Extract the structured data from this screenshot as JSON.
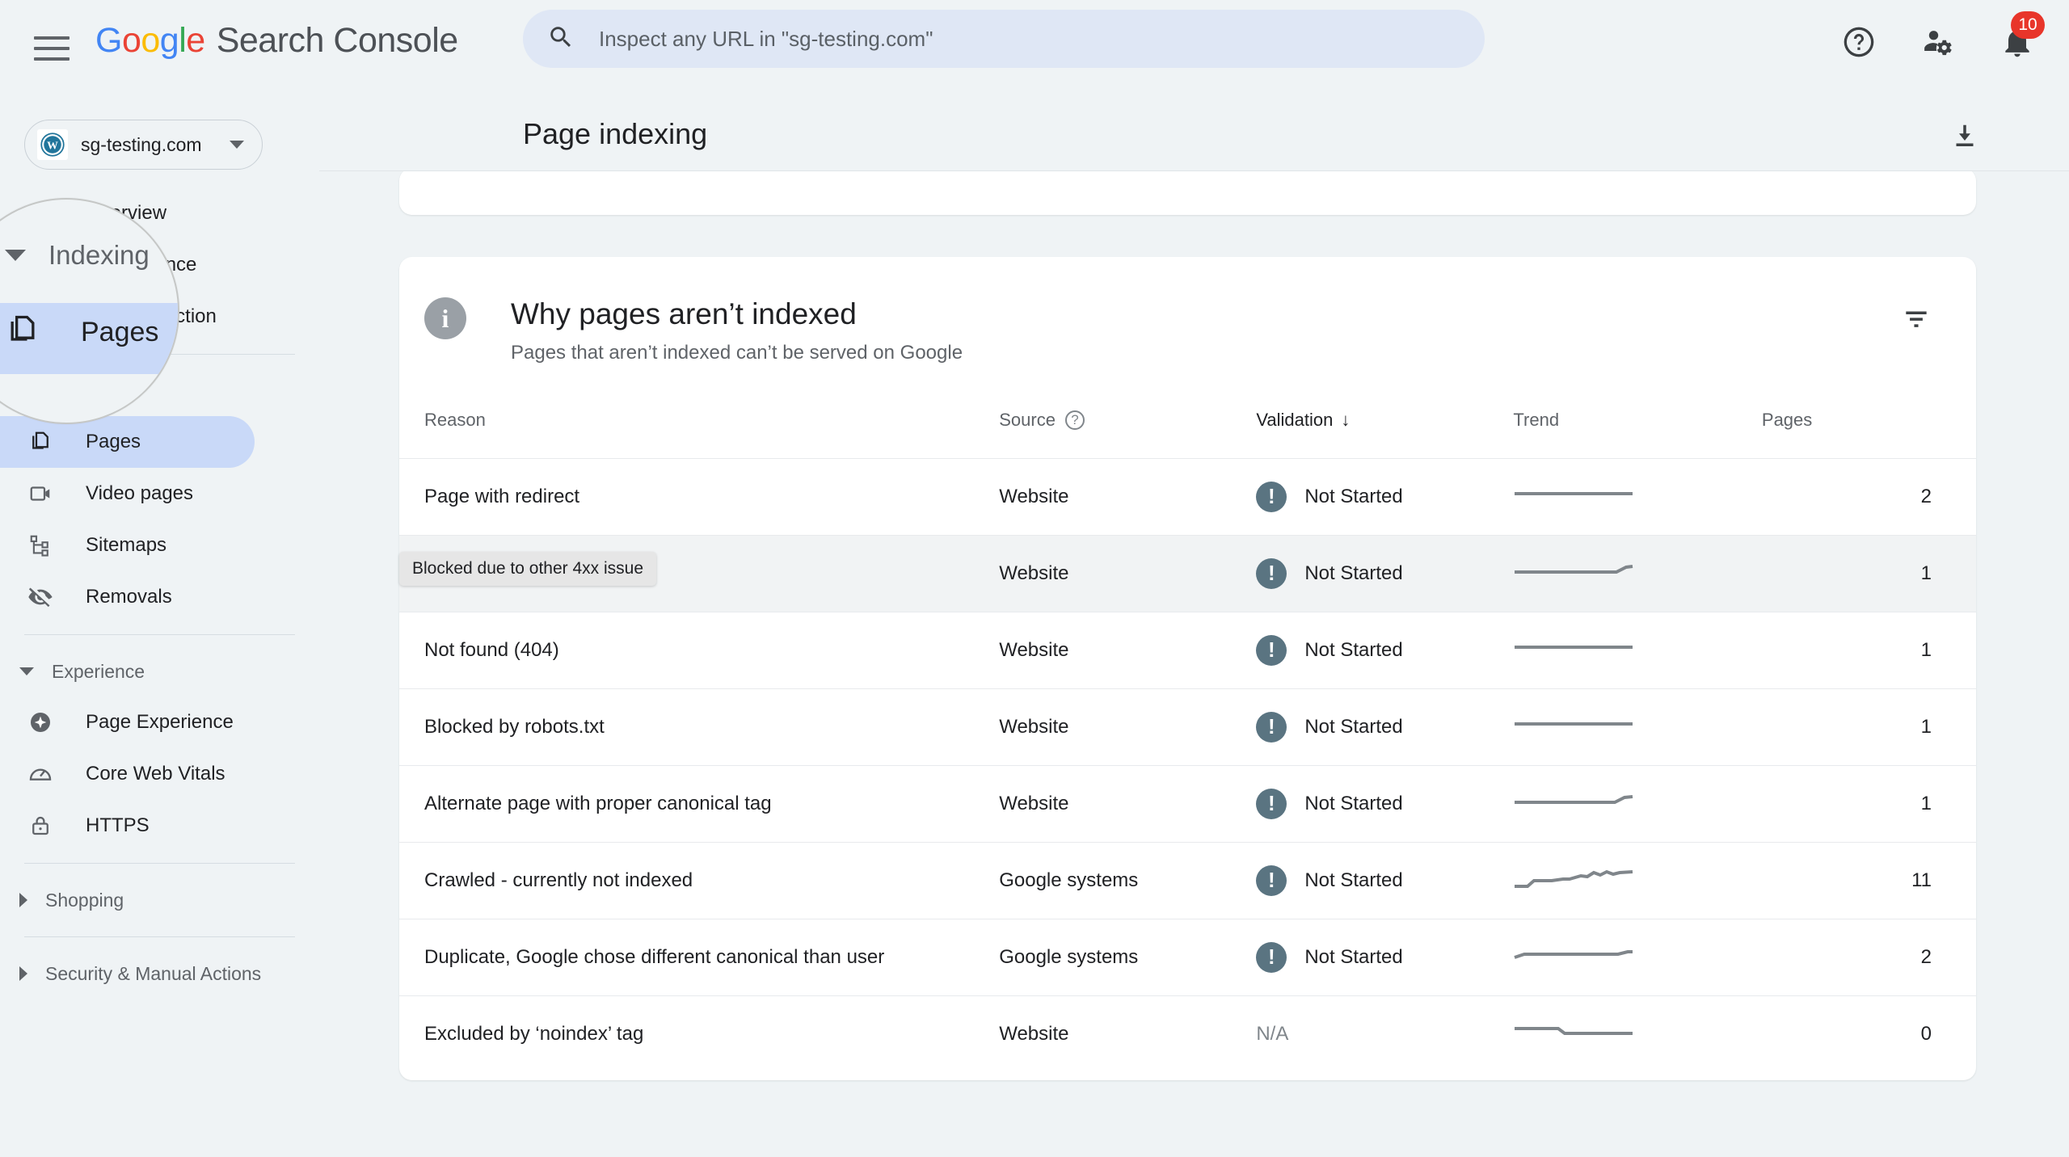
{
  "topbar": {
    "menu_label": "Main menu",
    "brand": {
      "g": "G",
      "o1": "o",
      "o2": "o",
      "g2": "g",
      "l": "l",
      "e": "e",
      "product": "Search Console"
    },
    "search": {
      "placeholder": "Inspect any URL in \"sg-testing.com\"",
      "value": ""
    },
    "icons": {
      "help": "help-icon",
      "account": "account-settings-icon",
      "notifications": "notifications-bell-icon"
    },
    "notification_count": "10"
  },
  "sidebar": {
    "property": {
      "name": "sg-testing.com",
      "icon": "wordpress-icon"
    },
    "items": [
      {
        "label": "Overview",
        "icon": "home-icon",
        "active": false
      },
      {
        "label": "Performance",
        "icon": "trending-up-icon",
        "active": false
      },
      {
        "label": "URL inspection",
        "icon": "search-icon",
        "active": false
      }
    ],
    "indexing_section": {
      "label": "Indexing",
      "expanded": true
    },
    "indexing_items": [
      {
        "label": "Pages",
        "icon": "pages-icon",
        "active": true
      },
      {
        "label": "Video pages",
        "icon": "video-icon",
        "active": false
      },
      {
        "label": "Sitemaps",
        "icon": "sitemap-icon",
        "active": false
      },
      {
        "label": "Removals",
        "icon": "eye-off-icon",
        "active": false
      }
    ],
    "experience_section": {
      "label": "Experience",
      "expanded": true
    },
    "experience_items": [
      {
        "label": "Page Experience",
        "icon": "page-experience-icon"
      },
      {
        "label": "Core Web Vitals",
        "icon": "gauge-icon"
      },
      {
        "label": "HTTPS",
        "icon": "lock-icon"
      }
    ],
    "shopping_section": {
      "label": "Shopping",
      "expanded": false
    },
    "security_section": {
      "label": "Security & Manual Actions",
      "expanded": false
    }
  },
  "page": {
    "title": "Page indexing",
    "download_icon": "download-icon"
  },
  "report": {
    "heading": "Why pages aren’t indexed",
    "subheading": "Pages that aren’t indexed can’t be served on Google",
    "info_icon": "info-icon",
    "filter_icon": "filter-icon",
    "columns": {
      "reason": "Reason",
      "source": "Source",
      "validation": "Validation",
      "trend": "Trend",
      "pages": "Pages"
    },
    "sort": {
      "column": "Validation",
      "direction": "down",
      "glyph": "↓"
    },
    "source_help_icon": "help-circle-icon",
    "tooltip": {
      "text": "Blocked due to other 4xx issue",
      "row_index": 1
    },
    "hovered_row_index": 1,
    "status_icon": "alert-icon",
    "rows": [
      {
        "reason": "Page with redirect",
        "source": "Website",
        "validation": "Not Started",
        "pages": "2",
        "trend": "flat"
      },
      {
        "reason": "Blocked due to other 4xx issue",
        "reason_visible": "e",
        "source": "Website",
        "validation": "Not Started",
        "pages": "1",
        "trend": "flat-up-end"
      },
      {
        "reason": "Not found (404)",
        "source": "Website",
        "validation": "Not Started",
        "pages": "1",
        "trend": "flat"
      },
      {
        "reason": "Blocked by robots.txt",
        "source": "Website",
        "validation": "Not Started",
        "pages": "1",
        "trend": "flat"
      },
      {
        "reason": "Alternate page with proper canonical tag",
        "source": "Website",
        "validation": "Not Started",
        "pages": "1",
        "trend": "flat-up-end"
      },
      {
        "reason": "Crawled - currently not indexed",
        "source": "Google systems",
        "validation": "Not Started",
        "pages": "11",
        "trend": "rising"
      },
      {
        "reason": "Duplicate, Google chose different canonical than user",
        "source": "Google systems",
        "validation": "Not Started",
        "pages": "2",
        "trend": "flat-slight"
      },
      {
        "reason": "Excluded by ‘noindex’ tag",
        "source": "Website",
        "validation": "N/A",
        "pages": "0",
        "trend": "step"
      }
    ]
  },
  "colors": {
    "page_bg": "#eff3f5",
    "card_bg": "#ffffff",
    "active_nav": "#c9d9f8",
    "search_bg": "#dfe7f5",
    "badge_red": "#e8352a",
    "status_slate": "#5a7481",
    "text_primary": "#202124",
    "text_secondary": "#5f6368",
    "sparkline": "#80868b"
  }
}
